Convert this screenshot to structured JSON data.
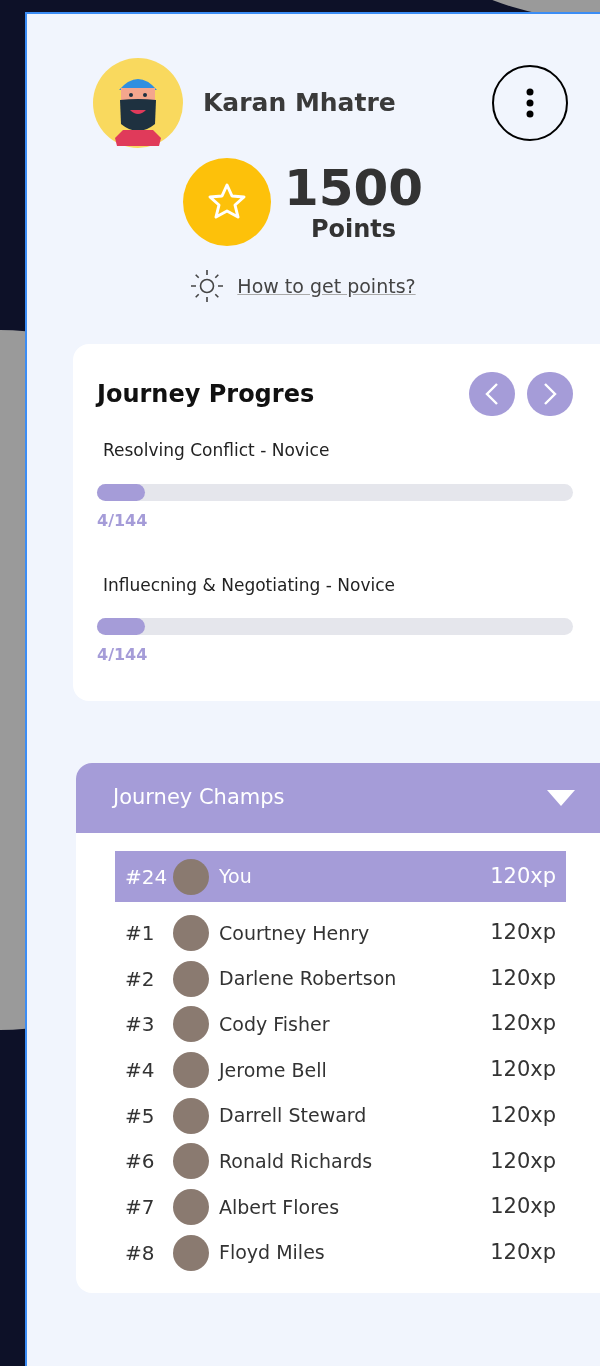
{
  "profile": {
    "name": "Karan Mhatre"
  },
  "points": {
    "value": "1500",
    "label": "Points",
    "help_link": "How to get points?"
  },
  "journey_progress": {
    "title": "Journey Progres",
    "items": [
      {
        "name": "Resolving Conflict - Novice",
        "level": 0.1,
        "count": "4/144"
      },
      {
        "name": "Influecning & Negotiating - Novice",
        "level": 0.1,
        "count": "4/144"
      }
    ]
  },
  "journey_champs": {
    "title": "Journey Champs",
    "expanded": true,
    "rows": [
      {
        "rank": "#24",
        "name": "You",
        "xp": "120xp",
        "selected": true
      },
      {
        "rank": "#1",
        "name": "Courtney Henry",
        "xp": "120xp",
        "selected": false
      },
      {
        "rank": "#2",
        "name": "Darlene Robertson",
        "xp": "120xp",
        "selected": false
      },
      {
        "rank": "#3",
        "name": "Cody Fisher",
        "xp": "120xp",
        "selected": false
      },
      {
        "rank": "#4",
        "name": "Jerome Bell",
        "xp": "120xp",
        "selected": false
      },
      {
        "rank": "#5",
        "name": "Darrell Steward",
        "xp": "120xp",
        "selected": false
      },
      {
        "rank": "#6",
        "name": "Ronald Richards",
        "xp": "120xp",
        "selected": false
      },
      {
        "rank": "#7",
        "name": "Albert Flores",
        "xp": "120xp",
        "selected": false
      },
      {
        "rank": "#8",
        "name": "Floyd Miles",
        "xp": "120xp",
        "selected": false
      }
    ]
  }
}
